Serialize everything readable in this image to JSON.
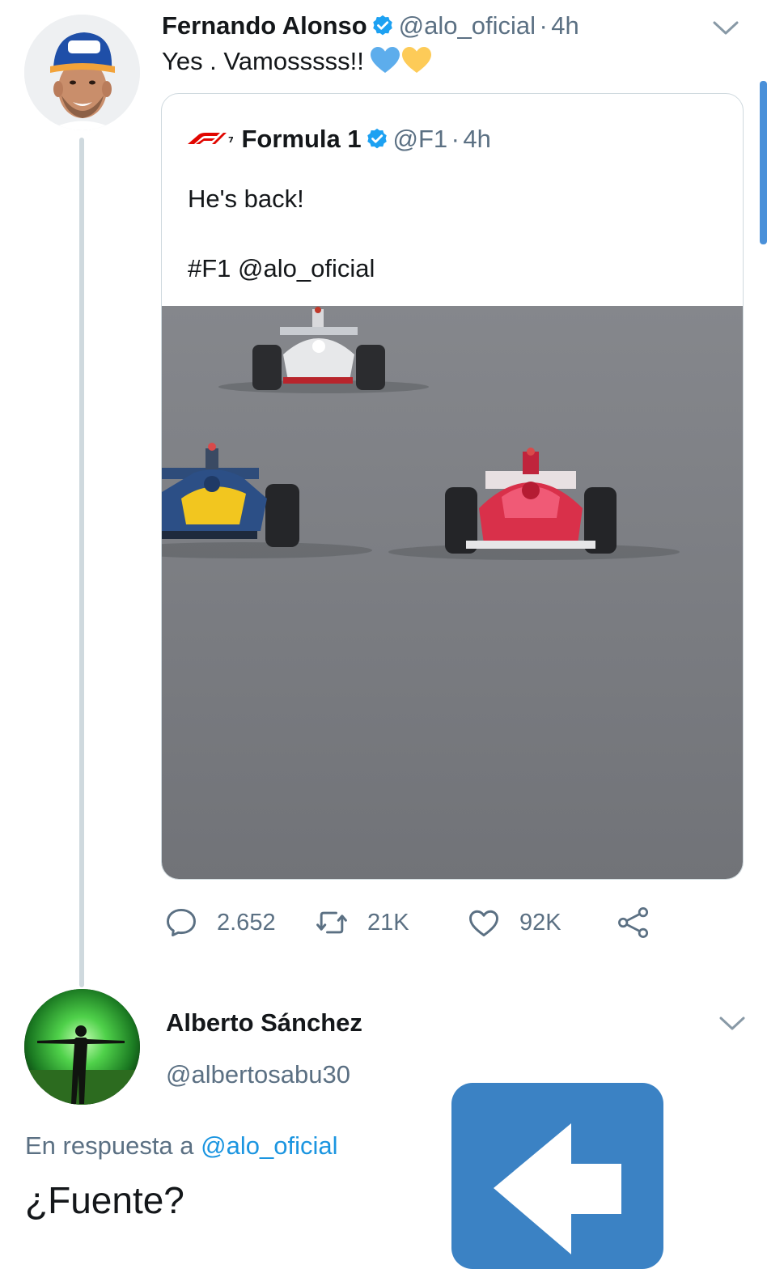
{
  "tweet": {
    "author_name": "Fernando Alonso",
    "author_handle": "@alo_oficial",
    "separator": "·",
    "time": "4h",
    "text": "Yes . Vamosssss!!",
    "emoji": [
      "blue-heart",
      "yellow-heart"
    ],
    "avatar_cap_text": "kimoa"
  },
  "quote": {
    "author_name": "Formula 1",
    "author_handle": "@F1",
    "separator": "·",
    "time": "4h",
    "text_line1": "He's back!",
    "text_line2": "#F1 @alo_oficial"
  },
  "actions": {
    "replies": "2.652",
    "retweets": "21K",
    "likes": "92K",
    "icons": [
      "reply-icon",
      "retweet-icon",
      "like-icon",
      "share-icon"
    ]
  },
  "reply": {
    "author_name": "Alberto Sánchez",
    "author_handle": "@albertosabu30",
    "in_reply_label": "En respuesta a",
    "in_reply_handle": "@alo_oficial",
    "text": "¿Fuente?"
  },
  "colors": {
    "verified": "#1da1f2",
    "link": "#1b95e0",
    "secondary_text": "#5b7083",
    "back_button": "#3b82c4",
    "scroll_thumb": "#4a90d9"
  }
}
